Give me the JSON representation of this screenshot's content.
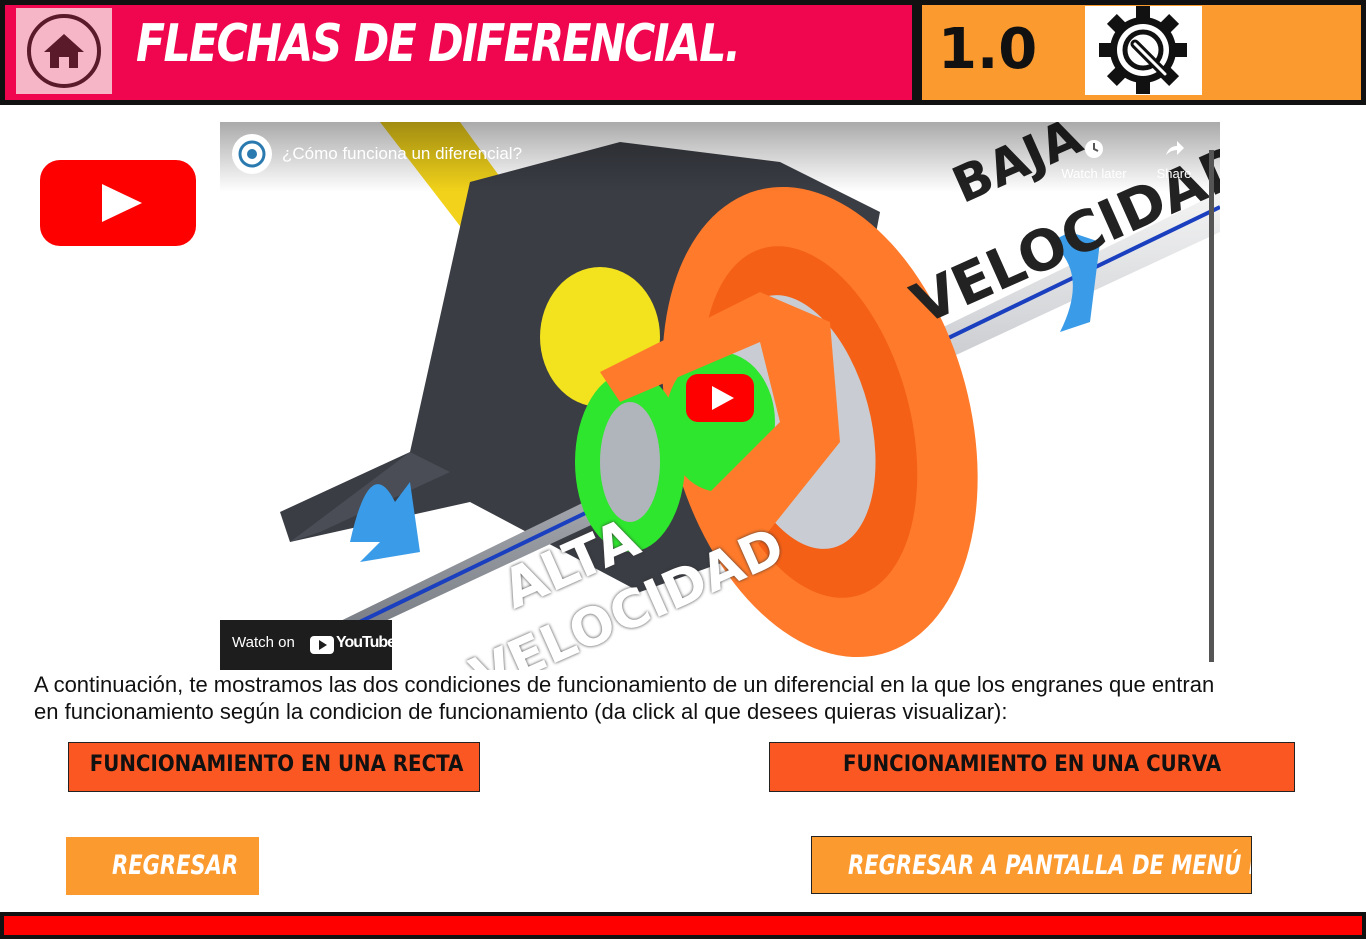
{
  "header": {
    "title": "FLECHAS DE DIFERENCIAL.",
    "version": "1.0",
    "home_icon": "home-icon",
    "settings_icon": "gear-wrench-icon"
  },
  "video": {
    "title": "¿Cómo funciona un diferencial?",
    "watch_later": "Watch later",
    "share": "Share",
    "watch_on": "Watch on",
    "youtube_brand": "YouTube",
    "overlay_low": [
      "BAJA",
      "VELOCIDAD"
    ],
    "overlay_high": [
      "ALTA",
      "VELOCIDAD"
    ]
  },
  "body": {
    "line1": "A continuación, te mostramos las dos condiciones de funcionamiento de un diferencial en la que  los engranes que entran",
    "line2": "en funcionamiento según la condicion de funcionamiento (da click al que desees quieras visualizar):"
  },
  "buttons": {
    "straight": "FUNCIONAMIENTO EN UNA RECTA",
    "curve": "FUNCIONAMIENTO EN UNA CURVA",
    "back": "REGRESAR",
    "main_menu": "REGRESAR A PANTALLA DE MENÚ PRINC"
  },
  "colors": {
    "header_pink": "#f0064e",
    "header_orange": "#fb9a2e",
    "mode_button": "#fb5722",
    "youtube_red": "#ff0000",
    "footer_red": "#ff0000"
  }
}
